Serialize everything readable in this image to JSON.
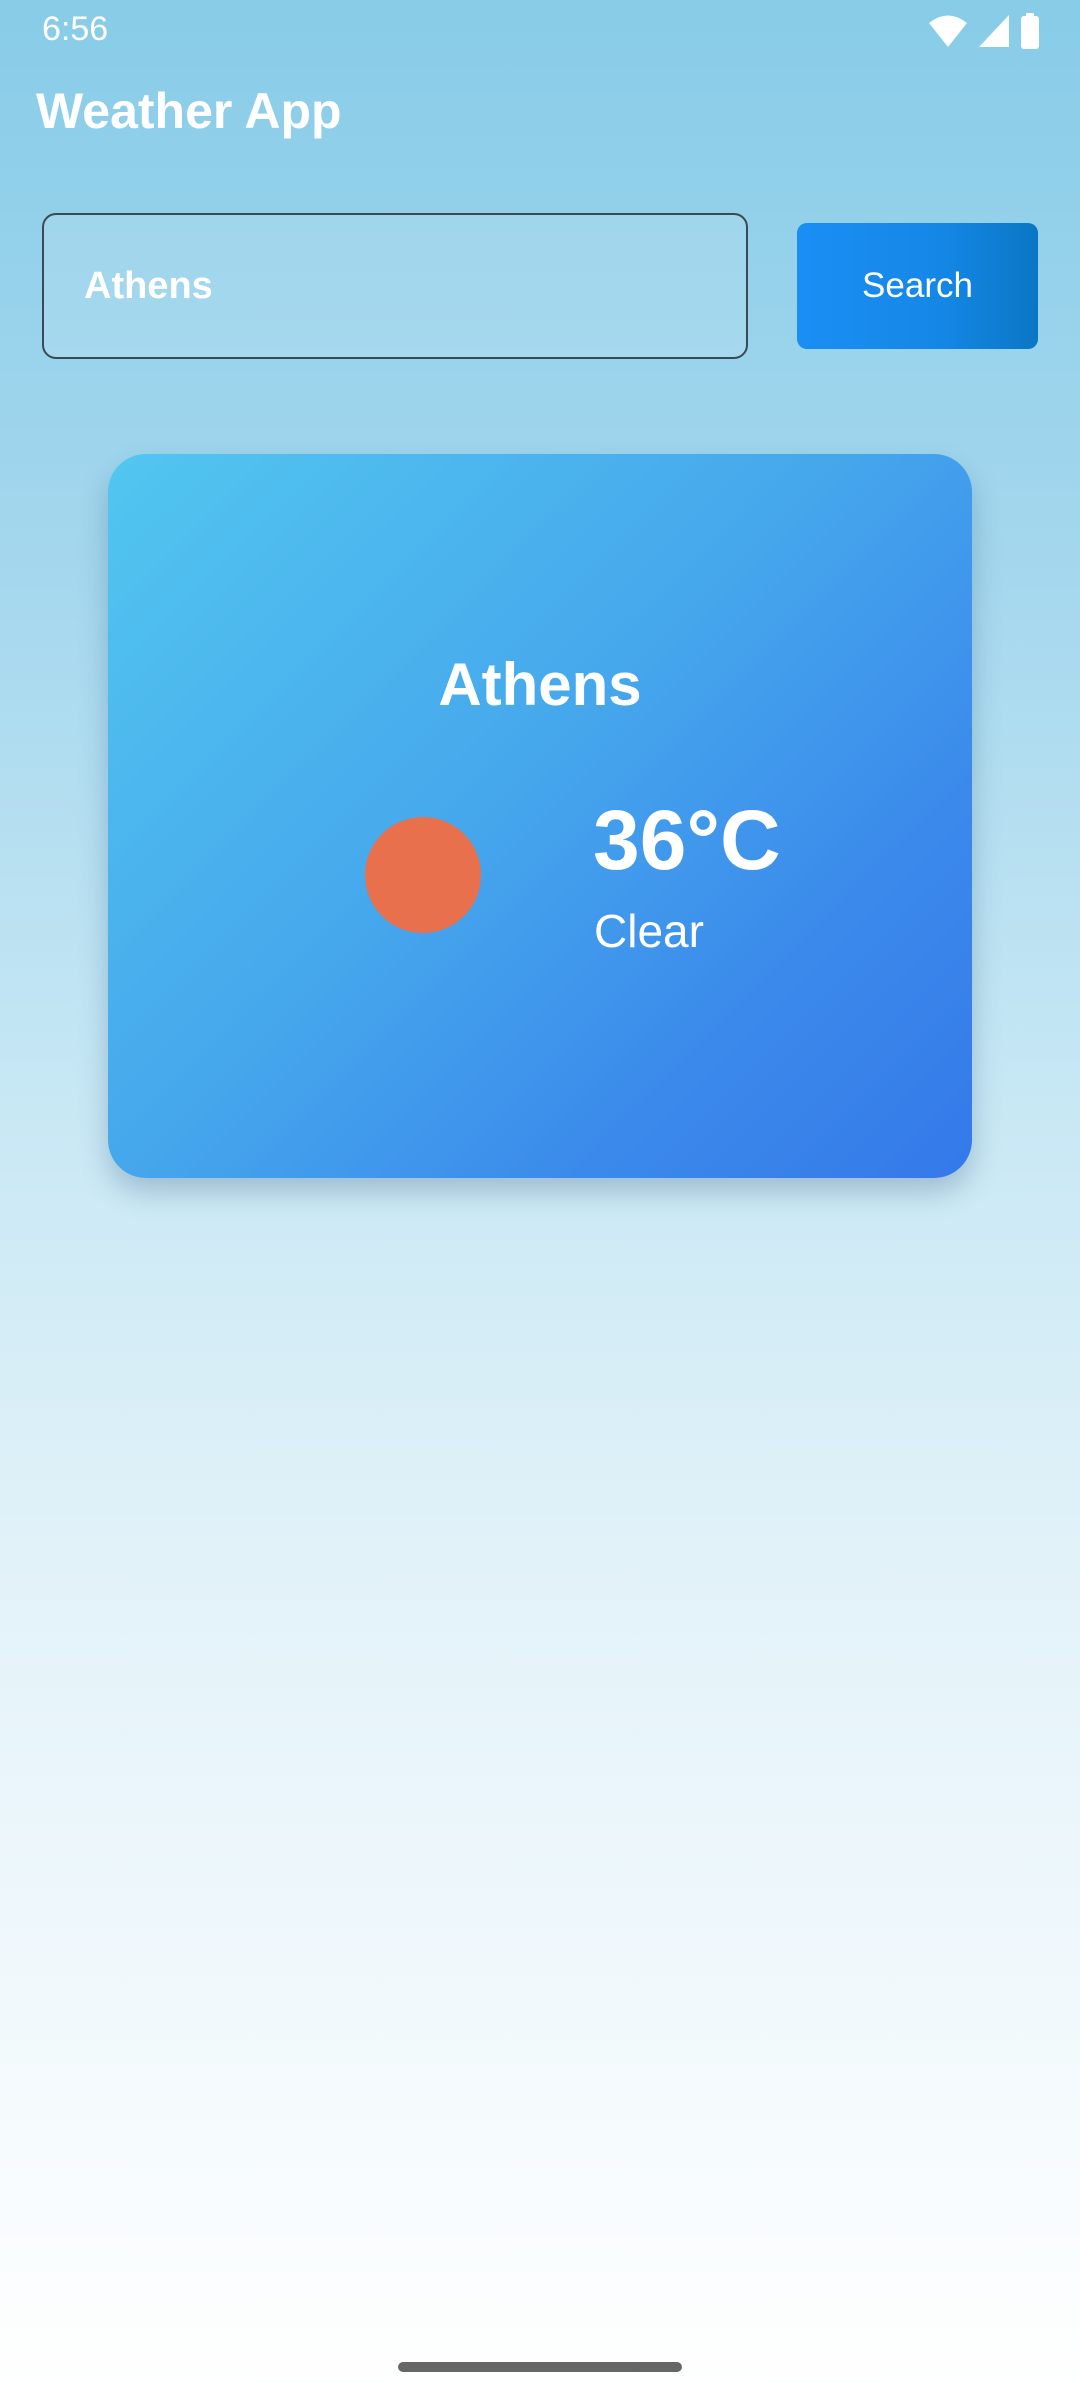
{
  "status_bar": {
    "time": "6:56",
    "icons": [
      "wifi-icon",
      "cell-signal-icon",
      "battery-icon"
    ]
  },
  "app": {
    "title": "Weather App"
  },
  "search": {
    "value": "Athens",
    "button_label": "Search"
  },
  "weather": {
    "city": "Athens",
    "temperature": "36°C",
    "condition": "Clear",
    "icon": "sun-icon",
    "icon_color": "#e9704c"
  },
  "colors": {
    "accent": "#1b8ef5",
    "card_start": "#52c6f0",
    "card_end": "#3479ea"
  }
}
